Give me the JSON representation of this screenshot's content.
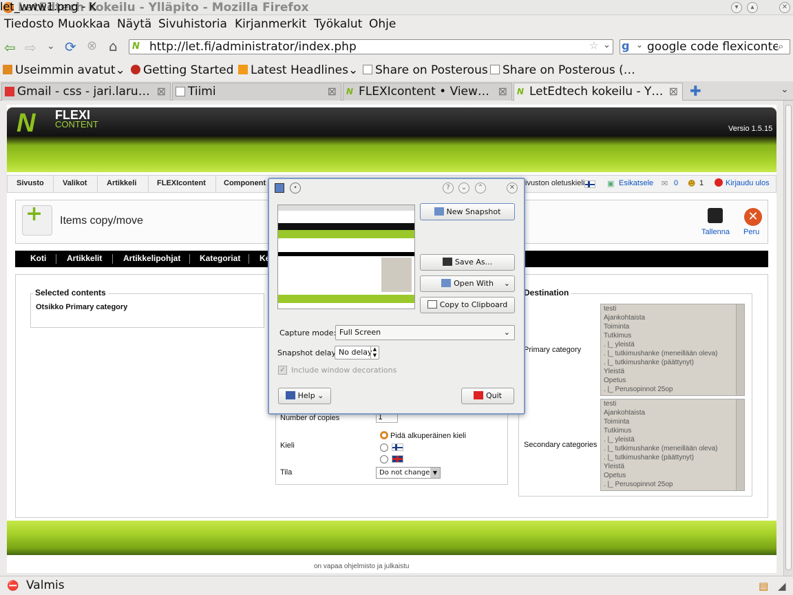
{
  "window": {
    "title": "LetEdtech kokeilu - Ylläpito - Mozilla Firefox"
  },
  "menubar": [
    "Tiedosto",
    "Muokkaa",
    "Näytä",
    "Sivuhistoria",
    "Kirjanmerkit",
    "Työkalut",
    "Ohje"
  ],
  "navbar": {
    "url": "http://let.fi/administrator/index.php",
    "search": "google code flexiconte"
  },
  "bookmarks": [
    "Useimmin avatut",
    "Getting Started",
    "Latest Headlines",
    "Share on Posterous",
    "Share on Posterous (…"
  ],
  "tabs": [
    {
      "label": "Gmail - css - jari.laru…"
    },
    {
      "label": "Tiimi"
    },
    {
      "label": "FLEXIcontent • View…"
    },
    {
      "label": "LetEdtech kokeilu - Y…"
    }
  ],
  "page": {
    "logo": {
      "line1": "FLEXI",
      "line2": "CONTENT"
    },
    "version": "Versio 1.5.15",
    "admin_menu": [
      "Sivusto",
      "Valikot",
      "Artikkeli",
      "FLEXIcontent",
      "Component"
    ],
    "status": {
      "lang": "ivuston oletuskieli:",
      "preview": "Esikatsele",
      "count0": "0",
      "count1": "1",
      "logout": "Kirjaudu ulos"
    },
    "title": "Items copy/move",
    "save": "Tallenna",
    "cancel": "Peru",
    "submenu": [
      "Koti",
      "Artikkelit",
      "Artikkelipohjat",
      "Kategoriat",
      "Ke"
    ],
    "selected_legend": "Selected contents",
    "selected_item": "Otsikko Primary category",
    "copies_label": "Number of copies",
    "copies_value": "1",
    "lang_label": "Kieli",
    "lang_keep": "Pidä alkuperäinen kieli",
    "state_label": "Tila",
    "state_value": "Do not change",
    "destination_legend": "Destination",
    "primary_label": "Primary category",
    "secondary_label": "Secondary categories",
    "categories": [
      "testi",
      "Ajankohtaista",
      "Toiminta",
      "Tutkimus",
      ".   |_ yleistä",
      ".   |_ tutkimushanke (meneillään oleva)",
      ".   |_ tutkimushanke (päättynyt)",
      "Yleistä",
      "Opetus",
      ".   |_ Perusopinnot 25op"
    ],
    "footer": "on vapaa ohjelmisto ja julkaistu"
  },
  "dialog": {
    "title": "let_www1.png - K",
    "new_snapshot": "New Snapshot",
    "save_as": "Save As...",
    "open_with": "Open With",
    "copy": "Copy to Clipboard",
    "capture_mode_label": "Capture mode:",
    "capture_mode_value": "Full Screen",
    "delay_label": "Snapshot delay:",
    "delay_value": "No delay",
    "include_decorations": "Include window decorations",
    "help": "Help",
    "quit": "Quit"
  },
  "statusbar": {
    "text": "Valmis"
  }
}
